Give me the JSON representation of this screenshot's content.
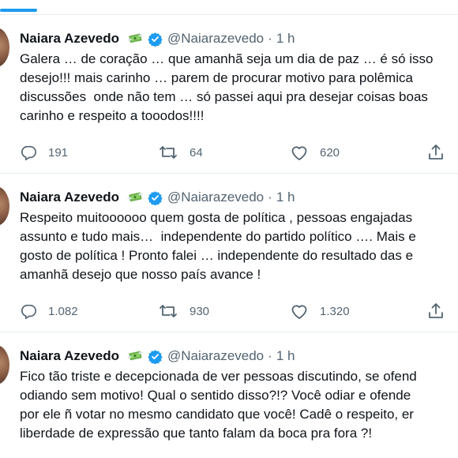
{
  "tweets": [
    {
      "name": "Naiara Azevedo",
      "handle": "@Naiarazevedo",
      "separator": "·",
      "time": "1 h",
      "lines": [
        "Galera … de coração … que amanhã seja um dia de paz … é só isso",
        "desejo!!! mais carinho … parem de procurar motivo para polêmica",
        "discussões  onde não tem … só passei aqui pra desejar coisas boas",
        "carinho e respeito a tooodos!!!!"
      ],
      "replies": "191",
      "retweets": "64",
      "likes": "620"
    },
    {
      "name": "Naiara Azevedo",
      "handle": "@Naiarazevedo",
      "separator": "·",
      "time": "1 h",
      "lines": [
        "Respeito muitoooooo quem gosta de política , pessoas engajadas",
        "assunto e tudo mais…  independente do partido político …. Mais e",
        "gosto de política ! Pronto falei … independente do resultado das e",
        "amanhã desejo que nosso país avance !"
      ],
      "replies": "1.082",
      "retweets": "930",
      "likes": "1.320"
    },
    {
      "name": "Naiara Azevedo",
      "handle": "@Naiarazevedo",
      "separator": "·",
      "time": "1 h",
      "lines": [
        "Fico tão triste e decepcionada de ver pessoas discutindo, se ofend",
        "odiando sem motivo! Qual o sentido disso?!? Você odiar e ofende",
        "por ele ñ votar no mesmo candidato que você! Cadê o respeito, er",
        "liberdade de expressão que tanto falam da boca pra fora ?!"
      ]
    }
  ],
  "icons": {
    "emoji": "money-with-wings-icon",
    "verified": "verified-badge-icon",
    "reply": "reply-icon",
    "retweet": "retweet-icon",
    "like": "heart-icon",
    "share": "share-icon"
  },
  "colors": {
    "accent": "#1d9bf0",
    "text": "#0f1419",
    "muted": "#536471",
    "divider": "#e6ecf0"
  }
}
